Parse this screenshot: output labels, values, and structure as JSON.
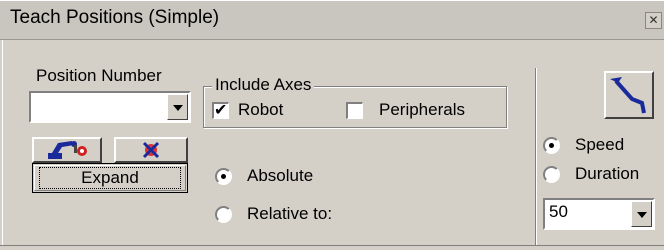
{
  "window": {
    "title": "Teach Positions (Simple)",
    "close_icon": "close-icon"
  },
  "position": {
    "label": "Position Number",
    "value": ""
  },
  "include_axes": {
    "label": "Include Axes",
    "robot": {
      "label": "Robot",
      "checked": true
    },
    "peripherals": {
      "label": "Peripherals",
      "checked": false
    }
  },
  "mode": {
    "absolute": "Absolute",
    "relative": "Relative to:",
    "selected": "absolute"
  },
  "buttons": {
    "expand": "Expand",
    "robot_icon": "robot-arm-icon",
    "clear_icon": "clear-target-icon",
    "path_icon": "move-path-icon"
  },
  "motion": {
    "speed": "Speed",
    "duration": "Duration",
    "selected": "speed",
    "value": "50"
  }
}
